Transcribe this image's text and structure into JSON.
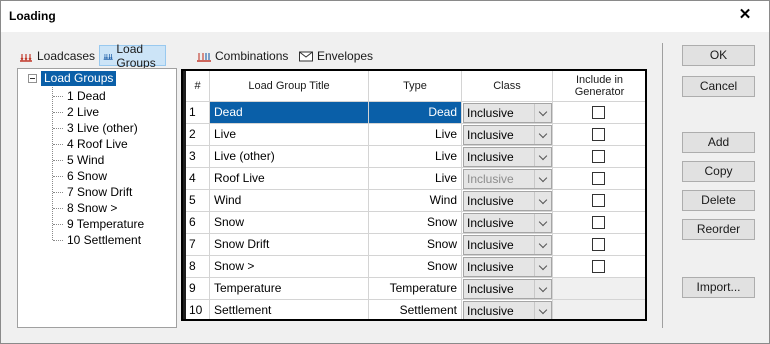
{
  "window": {
    "title": "Loading",
    "close_glyph": "✕"
  },
  "tabs": [
    {
      "label": "Loadcases",
      "icon": "loadcases-icon",
      "active": false
    },
    {
      "label": "Load Groups",
      "icon": "load-groups-icon",
      "active": true
    },
    {
      "label": "Combinations",
      "icon": "combinations-icon",
      "active": false
    },
    {
      "label": "Envelopes",
      "icon": "envelope-icon",
      "active": false
    }
  ],
  "tree": {
    "root": "Load Groups",
    "items": [
      "1 Dead",
      "2 Live",
      "3 Live (other)",
      "4 Roof Live",
      "5 Wind",
      "6 Snow",
      "7 Snow Drift",
      "8 Snow >",
      "9 Temperature",
      "10 Settlement"
    ]
  },
  "grid": {
    "columns": [
      "#",
      "Load Group Title",
      "Type",
      "Class",
      "Include in Generator"
    ],
    "rows": [
      {
        "num": "1",
        "title": "Dead",
        "type": "Dead",
        "class": "Inclusive",
        "class_disabled": false,
        "include": false,
        "has_include": true,
        "selected": true
      },
      {
        "num": "2",
        "title": "Live",
        "type": "Live",
        "class": "Inclusive",
        "class_disabled": false,
        "include": false,
        "has_include": true,
        "selected": false
      },
      {
        "num": "3",
        "title": "Live (other)",
        "type": "Live",
        "class": "Inclusive",
        "class_disabled": false,
        "include": false,
        "has_include": true,
        "selected": false
      },
      {
        "num": "4",
        "title": "Roof Live",
        "type": "Live",
        "class": "Inclusive",
        "class_disabled": true,
        "include": false,
        "has_include": true,
        "selected": false
      },
      {
        "num": "5",
        "title": "Wind",
        "type": "Wind",
        "class": "Inclusive",
        "class_disabled": false,
        "include": false,
        "has_include": true,
        "selected": false
      },
      {
        "num": "6",
        "title": "Snow",
        "type": "Snow",
        "class": "Inclusive",
        "class_disabled": false,
        "include": false,
        "has_include": true,
        "selected": false
      },
      {
        "num": "7",
        "title": "Snow Drift",
        "type": "Snow",
        "class": "Inclusive",
        "class_disabled": false,
        "include": false,
        "has_include": true,
        "selected": false
      },
      {
        "num": "8",
        "title": "Snow >",
        "type": "Snow",
        "class": "Inclusive",
        "class_disabled": false,
        "include": false,
        "has_include": true,
        "selected": false
      },
      {
        "num": "9",
        "title": "Temperature",
        "type": "Temperature",
        "class": "Inclusive",
        "class_disabled": false,
        "include": false,
        "has_include": false,
        "selected": false
      },
      {
        "num": "10",
        "title": "Settlement",
        "type": "Settlement",
        "class": "Inclusive",
        "class_disabled": false,
        "include": false,
        "has_include": false,
        "selected": false
      }
    ]
  },
  "buttons": {
    "ok": "OK",
    "cancel": "Cancel",
    "add": "Add",
    "copy": "Copy",
    "delete": "Delete",
    "reorder": "Reorder",
    "import": "Import..."
  },
  "colors": {
    "selection": "#0a5fa8",
    "tab_active": "#cce4f7"
  }
}
